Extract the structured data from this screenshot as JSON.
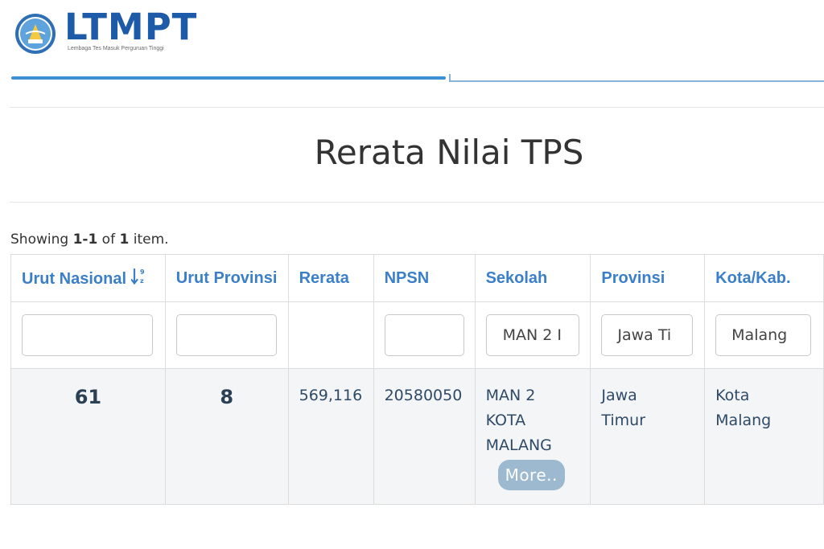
{
  "header": {
    "logo_text": "LTMPT",
    "logo_subtitle": "Lembaga Tes Masuk Perguruan Tinggi"
  },
  "page": {
    "title": "Rerata Nilai TPS"
  },
  "summary": {
    "prefix": "Showing ",
    "range": "1-1",
    "middle": " of ",
    "total": "1",
    "suffix": " item."
  },
  "table": {
    "columns": [
      {
        "label": "Urut Nasional"
      },
      {
        "label": "Urut Provinsi"
      },
      {
        "label": "Rerata"
      },
      {
        "label": "NPSN"
      },
      {
        "label": "Sekolah"
      },
      {
        "label": "Provinsi"
      },
      {
        "label": "Kota/Kab."
      }
    ],
    "filters": {
      "urut_nasional": "",
      "urut_provinsi": "",
      "npsn": "",
      "sekolah": "MAN 2 I",
      "provinsi": "Jawa Ti",
      "kota": "Malang"
    },
    "rows": [
      {
        "urut_nasional": "61",
        "urut_provinsi": "8",
        "rerata": "569,116",
        "npsn": "20580050",
        "sekolah_lines": [
          "MAN 2",
          "KOTA",
          "MALANG"
        ],
        "more_label": "More..",
        "provinsi_lines": [
          "Jawa",
          "Timur"
        ],
        "kota_lines": [
          "Kota",
          "Malang"
        ]
      }
    ]
  },
  "colors": {
    "brand": "#1d5aa8",
    "header_link": "#3a7fc7",
    "more_button": "#9cb9cf",
    "row_bg": "#f4f5f7"
  },
  "icons": {
    "sort": "sort-numeric-desc-icon",
    "logo": "tut-wuri-handayani-emblem-icon"
  }
}
